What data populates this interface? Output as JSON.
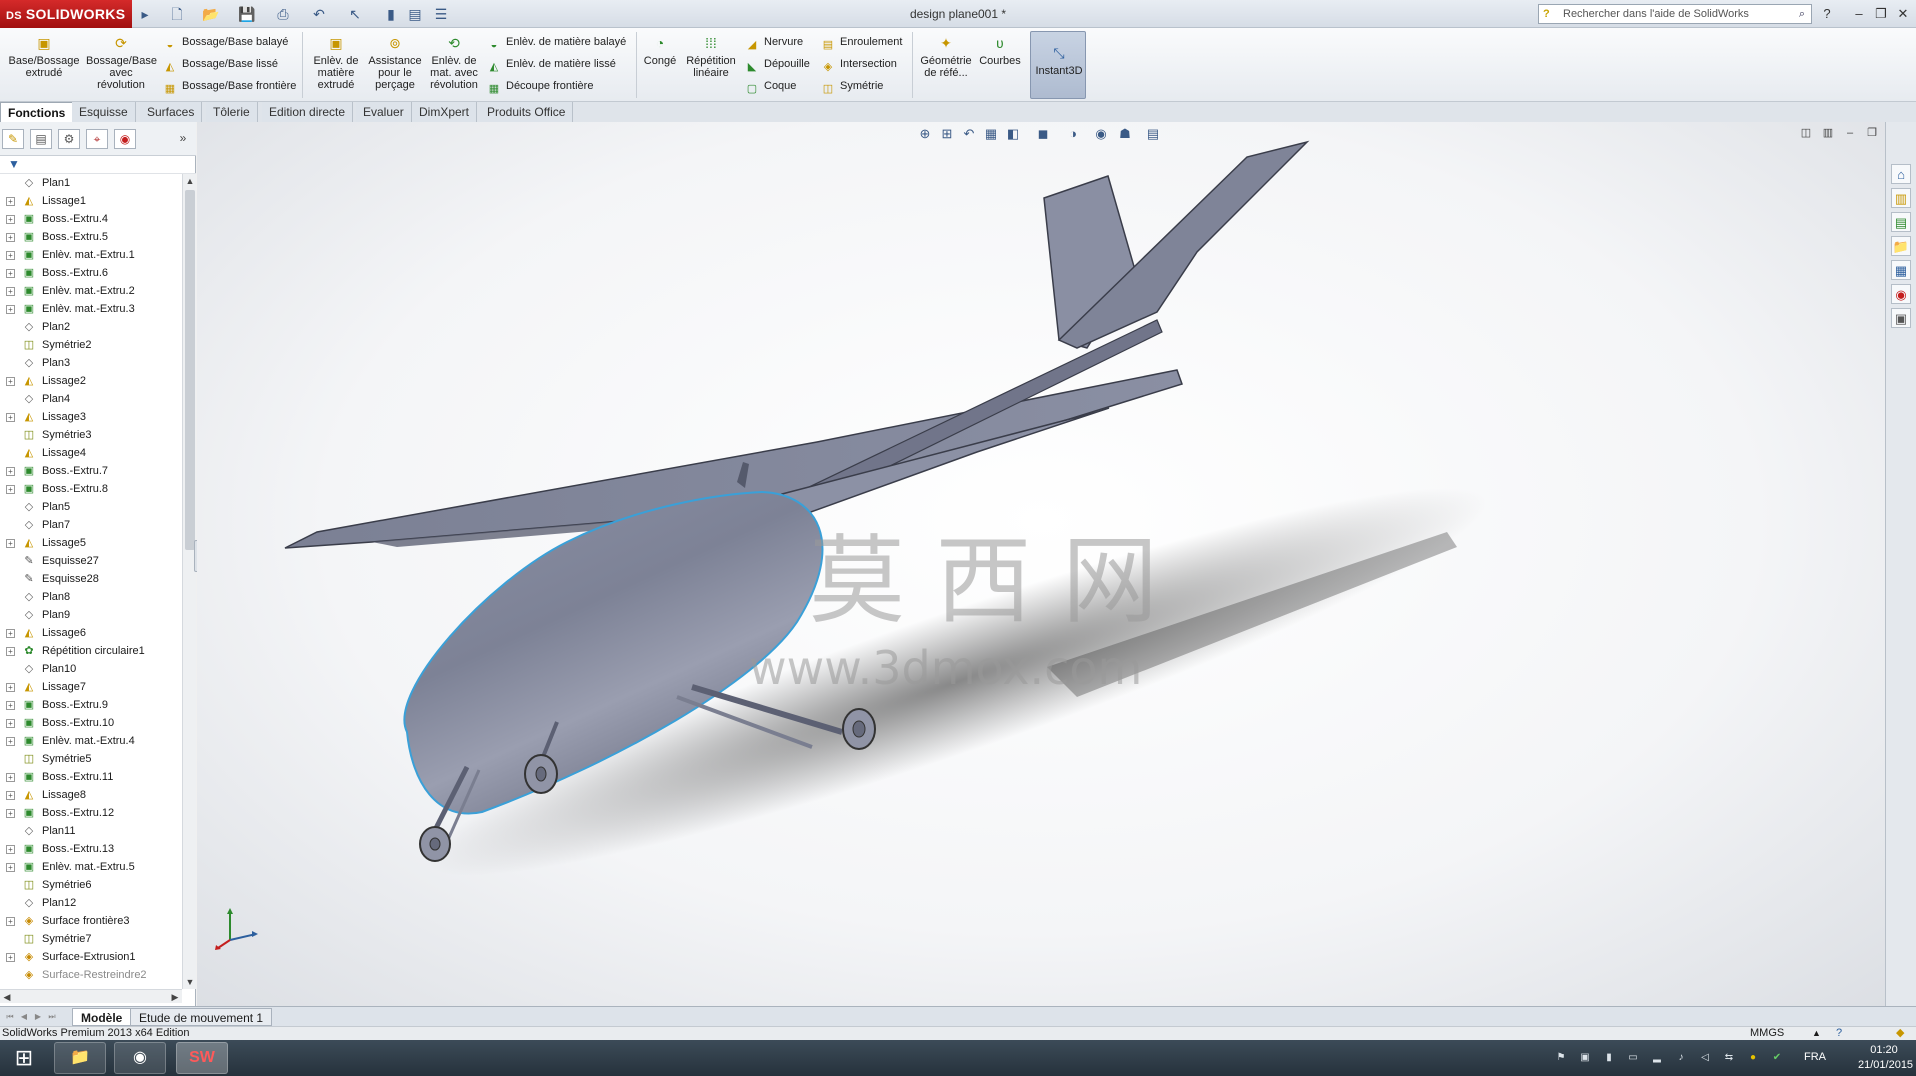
{
  "app": {
    "brand": "SOLIDWORKS",
    "document_title": "design plane001 *",
    "help_search_placeholder": "Rechercher dans l'aide de SolidWorks"
  },
  "ribbon": {
    "base_extrude": "Base/Bossage extrudé",
    "base_revolve": "Bossage/Base avec révolution",
    "swept_boss": "Bossage/Base balayé",
    "lofted_boss": "Bossage/Base lissé",
    "boundary_boss": "Bossage/Base frontière",
    "extruded_cut": "Enlèv. de matière extrudé",
    "hole_wizard": "Assistance pour le perçage",
    "revolved_cut": "Enlèv. de mat. avec révolution",
    "swept_cut": "Enlèv. de matière balayé",
    "lofted_cut": "Enlèv. de matière lissé",
    "boundary_cut": "Découpe frontière",
    "fillet": "Congé",
    "linear_pattern": "Répétition linéaire",
    "rib": "Nervure",
    "draft": "Dépouille",
    "shell": "Coque",
    "wrap": "Enroulement",
    "intersect": "Intersection",
    "mirror": "Symétrie",
    "reference_geometry": "Géométrie de réfé...",
    "curves": "Courbes",
    "instant3d": "Instant3D"
  },
  "tabs": [
    "Fonctions",
    "Esquisse",
    "Surfaces",
    "Tôlerie",
    "Edition directe",
    "Evaluer",
    "DimXpert",
    "Produits Office"
  ],
  "tree": [
    {
      "label": "Plan1",
      "icon": "plane",
      "exp": false
    },
    {
      "label": "Lissage1",
      "icon": "loft",
      "exp": true
    },
    {
      "label": "Boss.-Extru.4",
      "icon": "extru",
      "exp": true
    },
    {
      "label": "Boss.-Extru.5",
      "icon": "extru",
      "exp": true
    },
    {
      "label": "Enlèv. mat.-Extru.1",
      "icon": "cut",
      "exp": true
    },
    {
      "label": "Boss.-Extru.6",
      "icon": "extru",
      "exp": true
    },
    {
      "label": "Enlèv. mat.-Extru.2",
      "icon": "cut",
      "exp": true
    },
    {
      "label": "Enlèv. mat.-Extru.3",
      "icon": "cut",
      "exp": true
    },
    {
      "label": "Plan2",
      "icon": "plane",
      "exp": false
    },
    {
      "label": "Symétrie2",
      "icon": "mirror",
      "exp": false
    },
    {
      "label": "Plan3",
      "icon": "plane",
      "exp": false
    },
    {
      "label": "Lissage2",
      "icon": "loft",
      "exp": true
    },
    {
      "label": "Plan4",
      "icon": "plane",
      "exp": false
    },
    {
      "label": "Lissage3",
      "icon": "loft",
      "exp": true
    },
    {
      "label": "Symétrie3",
      "icon": "mirror",
      "exp": false
    },
    {
      "label": "Lissage4",
      "icon": "loft",
      "exp": false
    },
    {
      "label": "Boss.-Extru.7",
      "icon": "extru",
      "exp": true
    },
    {
      "label": "Boss.-Extru.8",
      "icon": "extru",
      "exp": true
    },
    {
      "label": "Plan5",
      "icon": "plane",
      "exp": false
    },
    {
      "label": "Plan7",
      "icon": "plane",
      "exp": false
    },
    {
      "label": "Lissage5",
      "icon": "loft",
      "exp": true
    },
    {
      "label": "Esquisse27",
      "icon": "sketch",
      "exp": false
    },
    {
      "label": "Esquisse28",
      "icon": "sketch",
      "exp": false
    },
    {
      "label": "Plan8",
      "icon": "plane",
      "exp": false
    },
    {
      "label": "Plan9",
      "icon": "plane",
      "exp": false
    },
    {
      "label": "Lissage6",
      "icon": "loft",
      "exp": true
    },
    {
      "label": "Répétition circulaire1",
      "icon": "pattern",
      "exp": true
    },
    {
      "label": "Plan10",
      "icon": "plane",
      "exp": false
    },
    {
      "label": "Lissage7",
      "icon": "loft",
      "exp": true
    },
    {
      "label": "Boss.-Extru.9",
      "icon": "extru",
      "exp": true
    },
    {
      "label": "Boss.-Extru.10",
      "icon": "extru",
      "exp": true
    },
    {
      "label": "Enlèv. mat.-Extru.4",
      "icon": "cut",
      "exp": true
    },
    {
      "label": "Symétrie5",
      "icon": "mirror",
      "exp": false
    },
    {
      "label": "Boss.-Extru.11",
      "icon": "extru",
      "exp": true
    },
    {
      "label": "Lissage8",
      "icon": "loft",
      "exp": true
    },
    {
      "label": "Boss.-Extru.12",
      "icon": "extru",
      "exp": true
    },
    {
      "label": "Plan11",
      "icon": "plane",
      "exp": false
    },
    {
      "label": "Boss.-Extru.13",
      "icon": "extru",
      "exp": true
    },
    {
      "label": "Enlèv. mat.-Extru.5",
      "icon": "cut",
      "exp": true
    },
    {
      "label": "Symétrie6",
      "icon": "mirror",
      "exp": false
    },
    {
      "label": "Plan12",
      "icon": "plane",
      "exp": false
    },
    {
      "label": "Surface frontière3",
      "icon": "surf",
      "exp": true
    },
    {
      "label": "Symétrie7",
      "icon": "mirror",
      "exp": false
    },
    {
      "label": "Surface-Extrusion1",
      "icon": "surf",
      "exp": true
    },
    {
      "label": "Surface-Restreindre2",
      "icon": "surf",
      "exp": false,
      "dim": true
    }
  ],
  "watermark": {
    "chars": "莫  西  网",
    "url": "www.3dmox.com"
  },
  "bottom_tabs": [
    "Modèle",
    "Etude de mouvement 1"
  ],
  "status": {
    "text": "SolidWorks Premium 2013 x64 Edition",
    "units": "MMGS"
  },
  "taskbar": {
    "language": "FRA",
    "time": "01:20",
    "date": "21/01/2015"
  },
  "colors": {
    "brand_red": "#c41e1e",
    "model_body": "#7d8296",
    "edge_highlight": "#3aa0d8"
  }
}
